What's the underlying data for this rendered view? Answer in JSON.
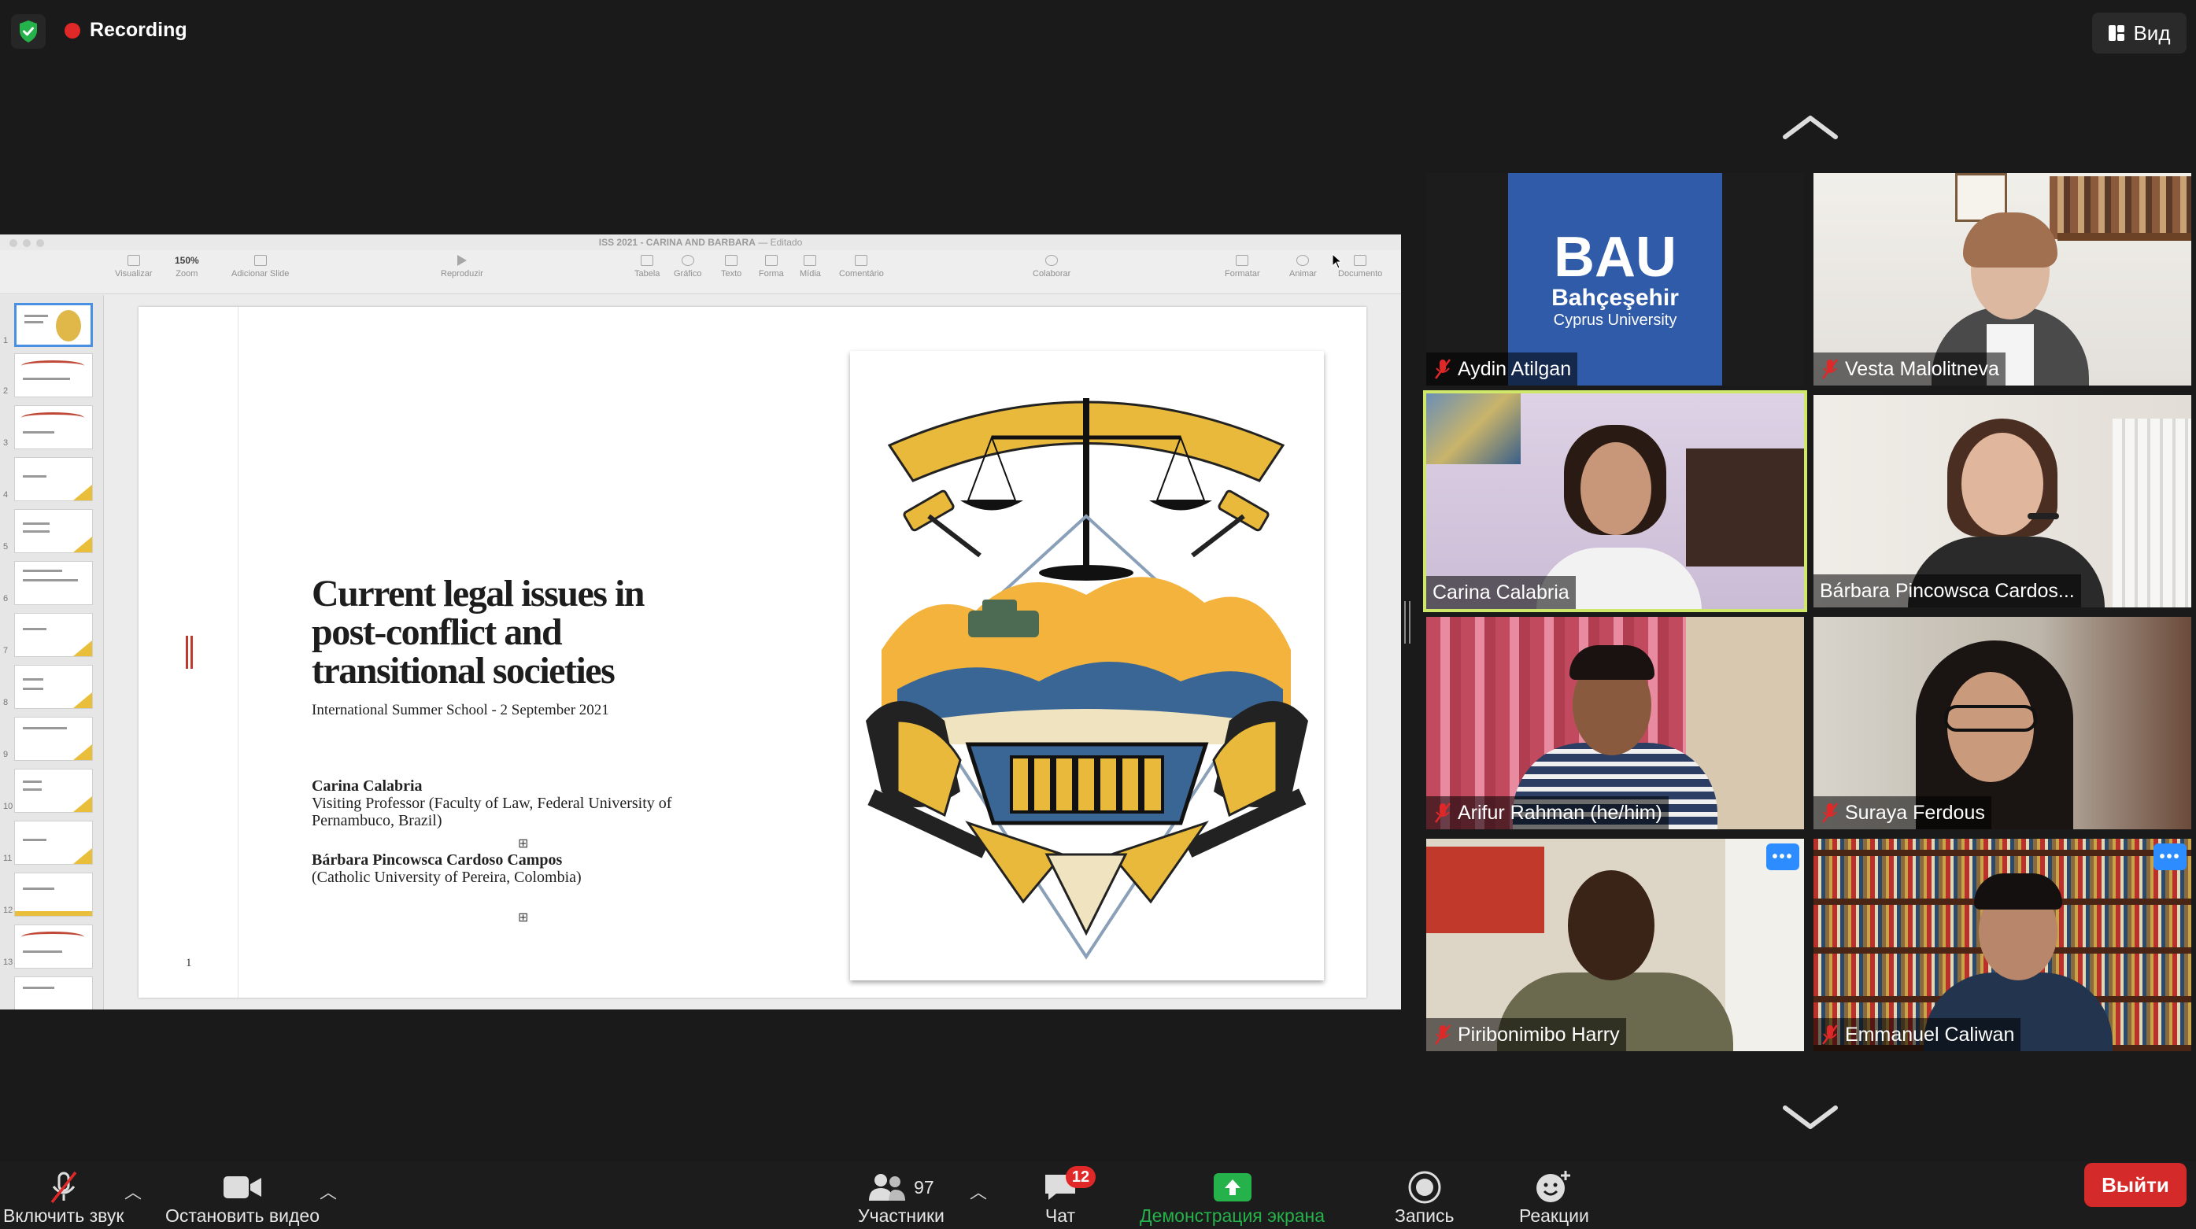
{
  "topbar": {
    "recording_label": "Recording",
    "view_label": "Вид",
    "shield_icon": "shield-check-icon",
    "colors": {
      "shield": "#25b24a",
      "recording_dot": "#e02828"
    }
  },
  "keynote": {
    "window_title": "ISS 2021 - CARINA AND BARBARA",
    "window_state": "Editado",
    "zoom_value": "150%",
    "toolbar": {
      "view": "Visualizar",
      "zoom": "Zoom",
      "add_slide": "Adicionar Slide",
      "play": "Reproduzir",
      "table": "Tabela",
      "chart": "Gráfico",
      "text": "Texto",
      "shape": "Forma",
      "media": "Mídia",
      "comment": "Comentário",
      "collaborate": "Colaborar",
      "format": "Formatar",
      "animate": "Animar",
      "document": "Documento"
    },
    "slide_numbers": [
      "1",
      "2",
      "3",
      "4",
      "5",
      "6",
      "7",
      "8",
      "9",
      "10",
      "11",
      "12",
      "13"
    ]
  },
  "slide": {
    "title": "Current legal issues in post-conflict and transitional societies",
    "subtitle": "International Summer School - 2 September 2021",
    "author1_name": "Carina Calabria",
    "author1_affiliation": "Visiting Professor (Faculty of Law, Federal University of Pernambuco, Brazil)",
    "author2_name": "Bárbara Pincowsca Cardoso Campos",
    "author2_affiliation": "(Catholic University of Pereira, Colombia)",
    "page_number": "1",
    "accent_color": "#c0392b"
  },
  "gallery": {
    "participants": [
      {
        "name": "Aydin Atilgan",
        "muted": true
      },
      {
        "name": "Vesta Malolitneva",
        "muted": true
      },
      {
        "name": "Carina Calabria",
        "muted": false,
        "active_speaker": true
      },
      {
        "name": "Bárbara Pincowsca Cardos...",
        "muted": false
      },
      {
        "name": "Arifur Rahman (he/him)",
        "muted": true
      },
      {
        "name": "Suraya Ferdous",
        "muted": true
      },
      {
        "name": "Piribonimibo Harry",
        "muted": true
      },
      {
        "name": "Emmanuel Caliwan",
        "muted": true
      }
    ],
    "bau_logo": {
      "line1": "BAU",
      "line2": "Bahçeşehir",
      "line3": "Cyprus University",
      "color": "#2f5ba8"
    },
    "active_border_color": "#cfe86a"
  },
  "toolbar": {
    "unmute": "Включить звук",
    "stop_video": "Остановить видео",
    "participants": "Участники",
    "participants_count": "97",
    "chat": "Чат",
    "chat_badge": "12",
    "share_screen": "Демонстрация экрана",
    "record": "Запись",
    "reactions": "Реакции",
    "leave": "Выйти",
    "colors": {
      "share": "#25b24a",
      "leave": "#d42a2a",
      "badge": "#e02828"
    }
  }
}
